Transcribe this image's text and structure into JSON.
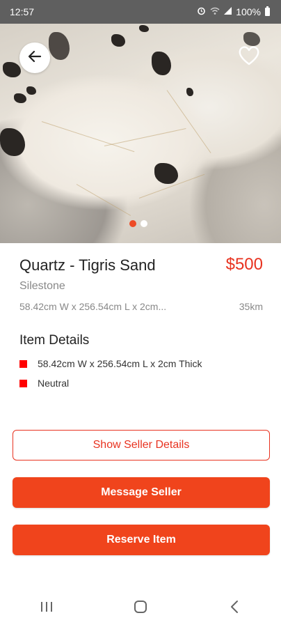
{
  "status_bar": {
    "time": "12:57",
    "battery_text": "100%",
    "icons": [
      "alarm-icon",
      "wifi-icon",
      "signal-icon",
      "battery-icon"
    ]
  },
  "hero": {
    "images_count": 2,
    "active_index": 0,
    "back_icon": "arrow-left-icon",
    "favorite_icon": "heart-outline-icon"
  },
  "product": {
    "title": "Quartz - Tigris Sand",
    "price": "$500",
    "brand": "Silestone",
    "dimensions_summary": "58.42cm W x 256.54cm L x 2cm...",
    "distance": "35km"
  },
  "item_details": {
    "heading": "Item Details",
    "items": [
      "58.42cm W x 256.54cm L x 2cm Thick",
      "Neutral"
    ]
  },
  "actions": {
    "show_seller": "Show Seller Details",
    "message_seller": "Message Seller",
    "reserve_item": "Reserve Item"
  },
  "nav": {
    "icons": [
      "recents-icon",
      "home-icon",
      "back-nav-icon"
    ]
  },
  "colors": {
    "accent": "#f0441c",
    "price": "#e8321f",
    "bullet": "#ff0000",
    "status_bar": "#5f5f5f"
  }
}
